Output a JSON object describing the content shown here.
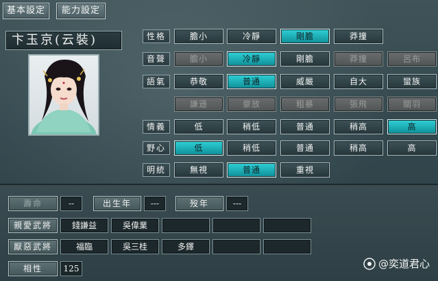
{
  "tabs": {
    "basic": "基本設定",
    "ability": "能力設定"
  },
  "character": {
    "name": "卞玉京(云裝)"
  },
  "rows": [
    {
      "key": "personality",
      "label": "性格",
      "options": [
        {
          "text": "膽小",
          "state": "normal"
        },
        {
          "text": "冷靜",
          "state": "normal"
        },
        {
          "text": "剛膽",
          "state": "active"
        },
        {
          "text": "莽撞",
          "state": "normal"
        }
      ]
    },
    {
      "key": "voice",
      "label": "音聲",
      "options": [
        {
          "text": "膽小",
          "state": "disabled"
        },
        {
          "text": "冷靜",
          "state": "active"
        },
        {
          "text": "剛膽",
          "state": "normal"
        },
        {
          "text": "莽撞",
          "state": "disabled"
        },
        {
          "text": "呂布",
          "state": "disabled"
        }
      ]
    },
    {
      "key": "tone",
      "label": "語氣",
      "options": [
        {
          "text": "恭敬",
          "state": "normal"
        },
        {
          "text": "普通",
          "state": "active"
        },
        {
          "text": "威嚴",
          "state": "normal"
        },
        {
          "text": "自大",
          "state": "normal"
        },
        {
          "text": "蠻族",
          "state": "normal"
        }
      ]
    },
    {
      "key": "tone2",
      "label": "",
      "options": [
        {
          "text": "謙遜",
          "state": "disabled"
        },
        {
          "text": "豪放",
          "state": "disabled"
        },
        {
          "text": "粗暴",
          "state": "disabled"
        },
        {
          "text": "張飛",
          "state": "disabled"
        },
        {
          "text": "關羽",
          "state": "disabled"
        }
      ]
    },
    {
      "key": "loyalty",
      "label": "情義",
      "options": [
        {
          "text": "低",
          "state": "normal"
        },
        {
          "text": "稍低",
          "state": "normal"
        },
        {
          "text": "普通",
          "state": "normal"
        },
        {
          "text": "稍高",
          "state": "normal"
        },
        {
          "text": "高",
          "state": "active"
        }
      ]
    },
    {
      "key": "ambition",
      "label": "野心",
      "options": [
        {
          "text": "低",
          "state": "active"
        },
        {
          "text": "稍低",
          "state": "normal"
        },
        {
          "text": "普通",
          "state": "normal"
        },
        {
          "text": "稍高",
          "state": "normal"
        },
        {
          "text": "高",
          "state": "normal"
        }
      ]
    },
    {
      "key": "enlightened",
      "label": "明統",
      "options": [
        {
          "text": "無視",
          "state": "normal"
        },
        {
          "text": "普通",
          "state": "active"
        },
        {
          "text": "重視",
          "state": "normal"
        }
      ]
    }
  ],
  "lower": {
    "lifespan_label": "壽命",
    "lifespan_value": "--",
    "birth_label": "出生年",
    "birth_value": "---",
    "death_label": "歿年",
    "death_value": "---",
    "liked_label": "親愛武將",
    "liked": [
      "錢謙益",
      "吳偉業",
      "",
      "",
      ""
    ],
    "disliked_label": "厭惡武將",
    "disliked": [
      "福臨",
      "吳三桂",
      "多鐸",
      "",
      ""
    ],
    "compat_label": "相性",
    "compat_value": "125"
  },
  "watermark": "@奕道君心",
  "colors": {
    "active": "#1fb8c0",
    "normal": "#33474c",
    "disabled": "#5e6262"
  }
}
